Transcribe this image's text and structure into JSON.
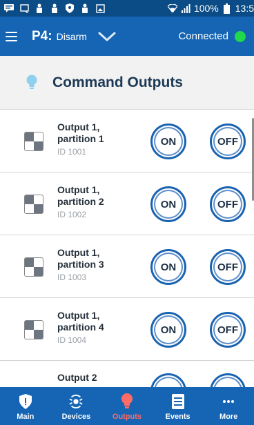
{
  "status_bar": {
    "icons": [
      "message-icon",
      "cast-icon",
      "person-icon",
      "person-icon",
      "shield-icon",
      "person-icon",
      "image-icon",
      "wifi-icon",
      "signal-icon"
    ],
    "battery": "100%",
    "time": "13:5"
  },
  "app_bar": {
    "partition": "P4:",
    "state": "Disarm",
    "connection": "Connected",
    "connection_color": "#20d84a"
  },
  "section": {
    "title": "Command Outputs",
    "icon": "bulb-icon"
  },
  "outputs": [
    {
      "title": "Output 1, partition 1",
      "id": "ID 1001",
      "on": "ON",
      "off": "OFF"
    },
    {
      "title": "Output 1, partition 2",
      "id": "ID 1002",
      "on": "ON",
      "off": "OFF"
    },
    {
      "title": "Output 1, partition 3",
      "id": "ID 1003",
      "on": "ON",
      "off": "OFF"
    },
    {
      "title": "Output 1, partition 4",
      "id": "ID 1004",
      "on": "ON",
      "off": "OFF"
    },
    {
      "title": "Output 2",
      "id": "",
      "on": "",
      "off": ""
    }
  ],
  "nav": {
    "items": [
      {
        "label": "Main",
        "icon": "shield-icon"
      },
      {
        "label": "Devices",
        "icon": "devices-icon"
      },
      {
        "label": "Outputs",
        "icon": "bulb-icon"
      },
      {
        "label": "Events",
        "icon": "list-icon"
      },
      {
        "label": "More",
        "icon": "dots-icon"
      }
    ],
    "active": "Outputs",
    "active_color": "#ff6b66"
  }
}
